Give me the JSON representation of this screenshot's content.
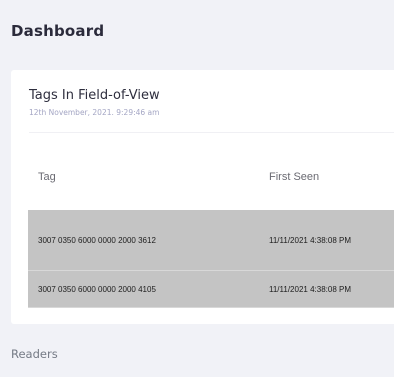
{
  "header": {
    "title": "Dashboard"
  },
  "card": {
    "title": "Tags In Field-of-View",
    "subtitle": "12th November, 2021. 9:29:46 am"
  },
  "table": {
    "columns": [
      "Tag",
      "First Seen"
    ],
    "rows": [
      {
        "tag": "3007 0350 6000 0000 2000 3612",
        "first_seen": "11/11/2021 4:38:08 PM"
      },
      {
        "tag": "3007 0350 6000 0000 2000 4105",
        "first_seen": "11/11/2021 4:38:08 PM"
      }
    ]
  },
  "readers": {
    "title": "Readers"
  }
}
